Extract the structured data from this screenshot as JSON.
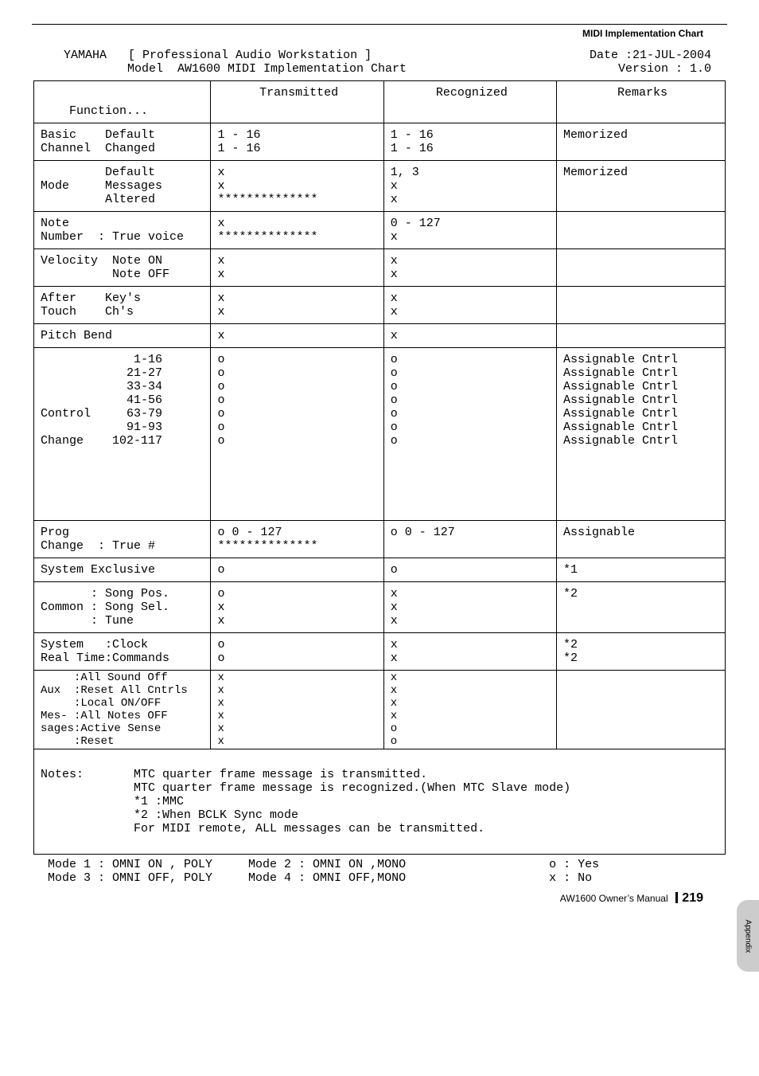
{
  "section_title": "MIDI Implementation Chart",
  "top": {
    "brand": "YAMAHA",
    "product": "[ Professional Audio Workstation ]",
    "date": "Date :21-JUL-2004",
    "model_line": "Model  AW1600 MIDI Implementation Chart",
    "version": "Version : 1.0"
  },
  "columns": {
    "function": "    Function...",
    "transmitted": "Transmitted",
    "recognized": "Recognized",
    "remarks": "Remarks"
  },
  "rows": [
    {
      "f": "Basic    Default\nChannel  Changed",
      "t": "1 - 16\n1 - 16",
      "r": "1 - 16\n1 - 16",
      "m": "Memorized"
    },
    {
      "f": "         Default\nMode     Messages\n         Altered",
      "t": "x\nx\n**************",
      "r": "1, 3\nx\nx",
      "m": "Memorized"
    },
    {
      "f": "Note\nNumber  : True voice",
      "t": "x\n**************",
      "r": "0 - 127\nx",
      "m": ""
    },
    {
      "f": "Velocity  Note ON\n          Note OFF",
      "t": "x\nx",
      "r": "x\nx",
      "m": ""
    },
    {
      "f": "After    Key's\nTouch    Ch's",
      "t": "x\nx",
      "r": "x\nx",
      "m": ""
    },
    {
      "f": "Pitch Bend",
      "t": "x",
      "r": "x",
      "m": ""
    },
    {
      "f": "             1-16\n            21-27\n            33-34\n            41-56\nControl     63-79\n            91-93\nChange    102-117\n\n\n\n\n\n",
      "t": "o\no\no\no\no\no\no",
      "r": "o\no\no\no\no\no\no",
      "m": "Assignable Cntrl\nAssignable Cntrl\nAssignable Cntrl\nAssignable Cntrl\nAssignable Cntrl\nAssignable Cntrl\nAssignable Cntrl"
    },
    {
      "f": "Prog\nChange  : True #",
      "t": "o 0 - 127\n**************",
      "r": "o 0 - 127",
      "m": "Assignable"
    },
    {
      "f": "System Exclusive",
      "t": "o",
      "r": "o",
      "m": "*1"
    },
    {
      "f": "       : Song Pos.\nCommon : Song Sel.\n       : Tune",
      "t": "o\nx\nx",
      "r": "x\nx\nx",
      "m": "*2"
    },
    {
      "f": "System   :Clock\nReal Time:Commands",
      "t": "o\no",
      "r": "x\nx",
      "m": "*2\n*2"
    },
    {
      "f": "     :All Sound Off\nAux  :Reset All Cntrls\n     :Local ON/OFF\nMes- :All Notes OFF\nsages:Active Sense\n     :Reset",
      "t": "x\nx\nx\nx\nx\nx",
      "r": "x\nx\nx\nx\no\no",
      "m": ""
    }
  ],
  "notes": {
    "label": "Notes:",
    "body": "MTC quarter frame message is transmitted.\nMTC quarter frame message is recognized.(When MTC Slave mode)\n*1 :MMC\n*2 :When BCLK Sync mode\nFor MIDI remote, ALL messages can be transmitted."
  },
  "modes": "Mode 1 : OMNI ON , POLY     Mode 2 : OMNI ON ,MONO                    o : Yes\nMode 3 : OMNI OFF, POLY     Mode 4 : OMNI OFF,MONO                    x : No",
  "footer": {
    "book": "AW1600  Owner’s Manual",
    "page": "219"
  },
  "sidebar": "Appendix",
  "chart_data": {
    "type": "table",
    "title": "YAMAHA AW1600 MIDI Implementation Chart",
    "date": "21-JUL-2004",
    "version": "1.0",
    "legend": {
      "o": "Yes",
      "x": "No"
    },
    "columns": [
      "Function",
      "Transmitted",
      "Recognized",
      "Remarks"
    ],
    "entries": [
      {
        "function_group": "Basic Channel",
        "item": "Default",
        "transmitted": "1 - 16",
        "recognized": "1 - 16",
        "remarks": "Memorized"
      },
      {
        "function_group": "Basic Channel",
        "item": "Changed",
        "transmitted": "1 - 16",
        "recognized": "1 - 16",
        "remarks": "Memorized"
      },
      {
        "function_group": "Mode",
        "item": "Default",
        "transmitted": "x",
        "recognized": "1, 3",
        "remarks": "Memorized"
      },
      {
        "function_group": "Mode",
        "item": "Messages",
        "transmitted": "x",
        "recognized": "x",
        "remarks": ""
      },
      {
        "function_group": "Mode",
        "item": "Altered",
        "transmitted": "**************",
        "recognized": "x",
        "remarks": ""
      },
      {
        "function_group": "Note Number",
        "item": "",
        "transmitted": "x",
        "recognized": "0 - 127",
        "remarks": ""
      },
      {
        "function_group": "Note Number",
        "item": "True voice",
        "transmitted": "**************",
        "recognized": "x",
        "remarks": ""
      },
      {
        "function_group": "Velocity",
        "item": "Note ON",
        "transmitted": "x",
        "recognized": "x",
        "remarks": ""
      },
      {
        "function_group": "Velocity",
        "item": "Note OFF",
        "transmitted": "x",
        "recognized": "x",
        "remarks": ""
      },
      {
        "function_group": "After Touch",
        "item": "Key's",
        "transmitted": "x",
        "recognized": "x",
        "remarks": ""
      },
      {
        "function_group": "After Touch",
        "item": "Ch's",
        "transmitted": "x",
        "recognized": "x",
        "remarks": ""
      },
      {
        "function_group": "Pitch Bend",
        "item": "",
        "transmitted": "x",
        "recognized": "x",
        "remarks": ""
      },
      {
        "function_group": "Control Change",
        "item": "1-16",
        "transmitted": "o",
        "recognized": "o",
        "remarks": "Assignable Cntrl"
      },
      {
        "function_group": "Control Change",
        "item": "21-27",
        "transmitted": "o",
        "recognized": "o",
        "remarks": "Assignable Cntrl"
      },
      {
        "function_group": "Control Change",
        "item": "33-34",
        "transmitted": "o",
        "recognized": "o",
        "remarks": "Assignable Cntrl"
      },
      {
        "function_group": "Control Change",
        "item": "41-56",
        "transmitted": "o",
        "recognized": "o",
        "remarks": "Assignable Cntrl"
      },
      {
        "function_group": "Control Change",
        "item": "63-79",
        "transmitted": "o",
        "recognized": "o",
        "remarks": "Assignable Cntrl"
      },
      {
        "function_group": "Control Change",
        "item": "91-93",
        "transmitted": "o",
        "recognized": "o",
        "remarks": "Assignable Cntrl"
      },
      {
        "function_group": "Control Change",
        "item": "102-117",
        "transmitted": "o",
        "recognized": "o",
        "remarks": "Assignable Cntrl"
      },
      {
        "function_group": "Prog Change",
        "item": "",
        "transmitted": "o 0 - 127",
        "recognized": "o 0 - 127",
        "remarks": "Assignable"
      },
      {
        "function_group": "Prog Change",
        "item": "True #",
        "transmitted": "**************",
        "recognized": "",
        "remarks": ""
      },
      {
        "function_group": "System Exclusive",
        "item": "",
        "transmitted": "o",
        "recognized": "o",
        "remarks": "*1"
      },
      {
        "function_group": "Common",
        "item": "Song Pos.",
        "transmitted": "o",
        "recognized": "x",
        "remarks": "*2"
      },
      {
        "function_group": "Common",
        "item": "Song Sel.",
        "transmitted": "x",
        "recognized": "x",
        "remarks": ""
      },
      {
        "function_group": "Common",
        "item": "Tune",
        "transmitted": "x",
        "recognized": "x",
        "remarks": ""
      },
      {
        "function_group": "System Real Time",
        "item": "Clock",
        "transmitted": "o",
        "recognized": "x",
        "remarks": "*2"
      },
      {
        "function_group": "System Real Time",
        "item": "Commands",
        "transmitted": "o",
        "recognized": "x",
        "remarks": "*2"
      },
      {
        "function_group": "Aux Messages",
        "item": "All Sound Off",
        "transmitted": "x",
        "recognized": "x",
        "remarks": ""
      },
      {
        "function_group": "Aux Messages",
        "item": "Reset All Cntrls",
        "transmitted": "x",
        "recognized": "x",
        "remarks": ""
      },
      {
        "function_group": "Aux Messages",
        "item": "Local ON/OFF",
        "transmitted": "x",
        "recognized": "x",
        "remarks": ""
      },
      {
        "function_group": "Aux Messages",
        "item": "All Notes OFF",
        "transmitted": "x",
        "recognized": "x",
        "remarks": ""
      },
      {
        "function_group": "Aux Messages",
        "item": "Active Sense",
        "transmitted": "x",
        "recognized": "o",
        "remarks": ""
      },
      {
        "function_group": "Aux Messages",
        "item": "Reset",
        "transmitted": "x",
        "recognized": "o",
        "remarks": ""
      }
    ],
    "notes": [
      "MTC quarter frame message is transmitted.",
      "MTC quarter frame message is recognized.(When MTC Slave mode)",
      "*1 :MMC",
      "*2 :When BCLK Sync mode",
      "For MIDI remote, ALL messages can be transmitted."
    ],
    "modes": {
      "1": "OMNI ON , POLY",
      "2": "OMNI ON ,MONO",
      "3": "OMNI OFF, POLY",
      "4": "OMNI OFF,MONO"
    }
  }
}
